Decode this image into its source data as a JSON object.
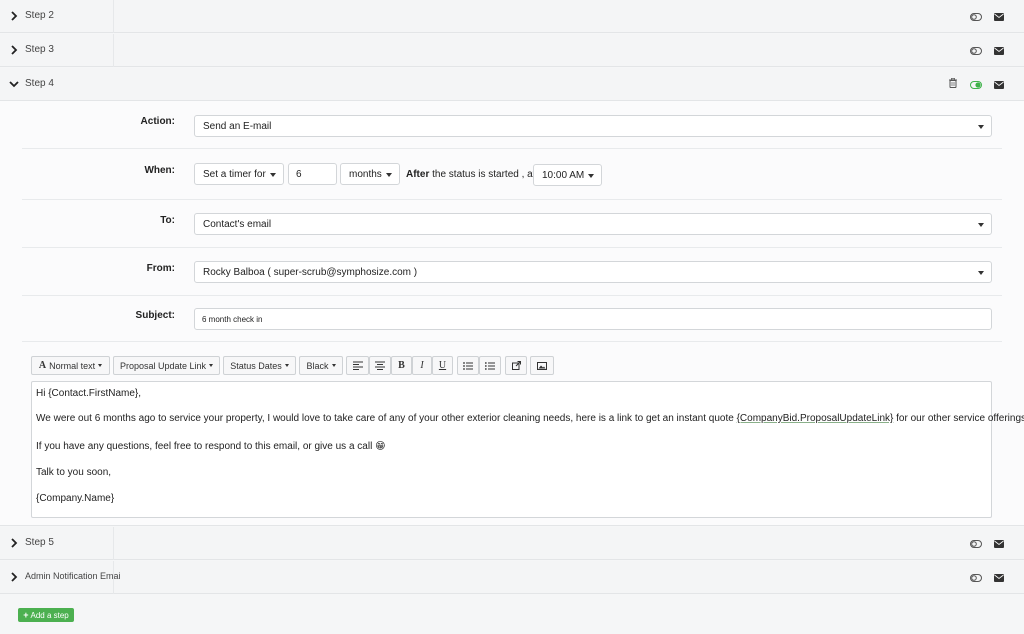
{
  "steps": {
    "step2": {
      "label": "Step 2"
    },
    "step3": {
      "label": "Step 3"
    },
    "step4": {
      "label": "Step 4"
    },
    "step5": {
      "label": "Step 5"
    },
    "admin": {
      "label": "Admin Notification Emai"
    }
  },
  "form": {
    "action": {
      "label": "Action:",
      "value": "Send an E-mail"
    },
    "when": {
      "label": "When:",
      "timer": "Set a timer for",
      "amount": "6",
      "unit": "months",
      "after_bold": "After",
      "after_rest": " the status is started , at",
      "time": "10:00 AM"
    },
    "to": {
      "label": "To:",
      "value": "Contact's email"
    },
    "from": {
      "label": "From:",
      "value": "Rocky Balboa ( super-scrub@symphosize.com )"
    },
    "subject": {
      "label": "Subject:",
      "value": "6 month check in"
    }
  },
  "toolbar": {
    "normal_text": "Normal text",
    "proposal_link": "Proposal Update Link",
    "status_dates": "Status Dates",
    "color": "Black"
  },
  "editor": {
    "line1": "Hi {Contact.FirstName},",
    "line2_pre": "We were out 6 months ago to service your property, I would love to take care of any of your other exterior cleaning needs, here is a link to get an instant quote ",
    "line2_link": "{CompanyBid.ProposalUpdateLink}",
    "line2_post": " for our other service offerings!",
    "line3": "If you have any questions, feel free to respond to this email, or give us a call 😁",
    "line4": "Talk to you soon,",
    "line5": "{Company.Name}"
  },
  "add_step": {
    "label": "Add a step"
  },
  "colors": {
    "accent_green": "#4cb050",
    "toggle_on": "#3fb24a"
  }
}
